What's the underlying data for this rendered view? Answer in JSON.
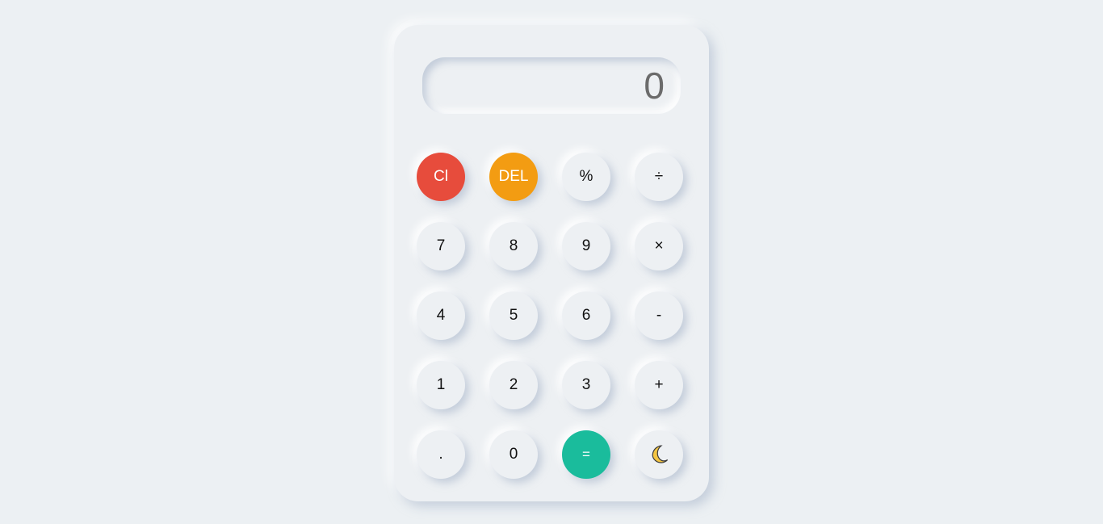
{
  "display": {
    "value": "0"
  },
  "buttons": {
    "clear": "Cl",
    "delete": "DEL",
    "percent": "%",
    "divide": "÷",
    "seven": "7",
    "eight": "8",
    "nine": "9",
    "multiply": "×",
    "four": "4",
    "five": "5",
    "six": "6",
    "subtract": "-",
    "one": "1",
    "two": "2",
    "three": "3",
    "add": "+",
    "decimal": ".",
    "zero": "0",
    "equals": "=",
    "theme_icon": "moon-icon"
  },
  "colors": {
    "background": "#ecf0f3",
    "clear": "#e74c3c",
    "delete": "#f39c12",
    "equals": "#1abc9c",
    "moon": "#f4c542"
  }
}
